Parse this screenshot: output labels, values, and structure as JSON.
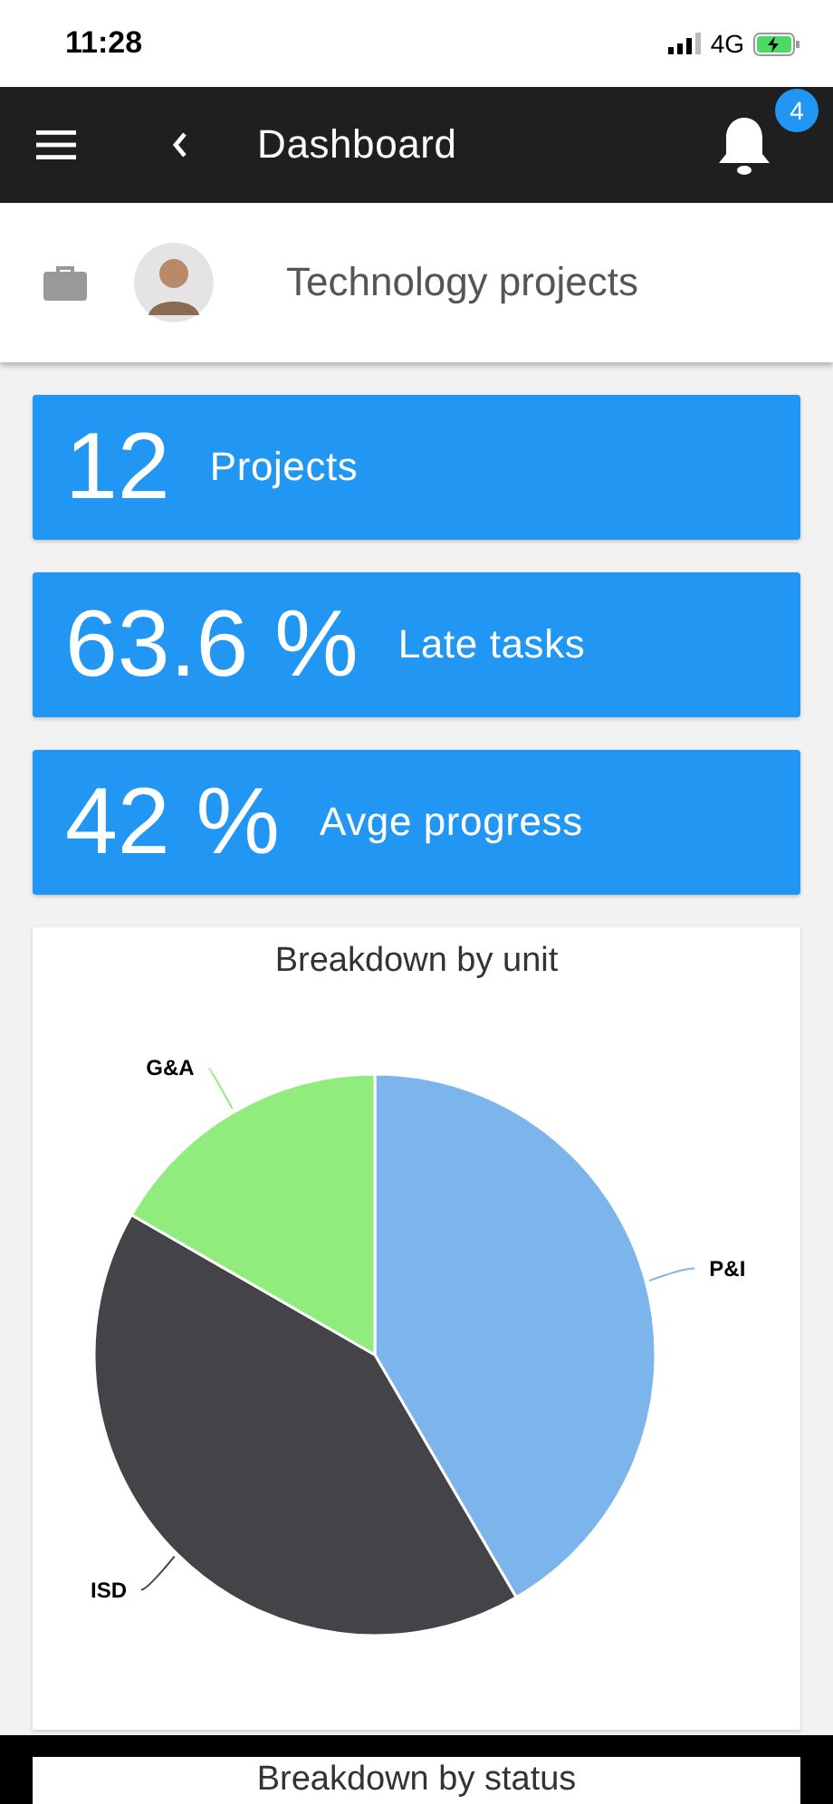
{
  "status_bar": {
    "time": "11:28",
    "network": "4G"
  },
  "nav_bar": {
    "title": "Dashboard",
    "notification_count": "4"
  },
  "header": {
    "title": "Technology projects"
  },
  "stat_cards": [
    {
      "value": "12",
      "label": "Projects"
    },
    {
      "value": "63.6 %",
      "label": "Late tasks"
    },
    {
      "value": "42 %",
      "label": "Avge progress"
    }
  ],
  "unit_chart": {
    "title": "Breakdown by unit",
    "chart_data": {
      "type": "pie",
      "categories": [
        "P&I",
        "ISD",
        "G&A"
      ],
      "values": [
        41.6,
        41.7,
        16.7
      ],
      "colors": [
        "#7cb5ec",
        "#434348",
        "#90ed7d"
      ]
    }
  },
  "status_chart": {
    "title": "Breakdown by status"
  }
}
